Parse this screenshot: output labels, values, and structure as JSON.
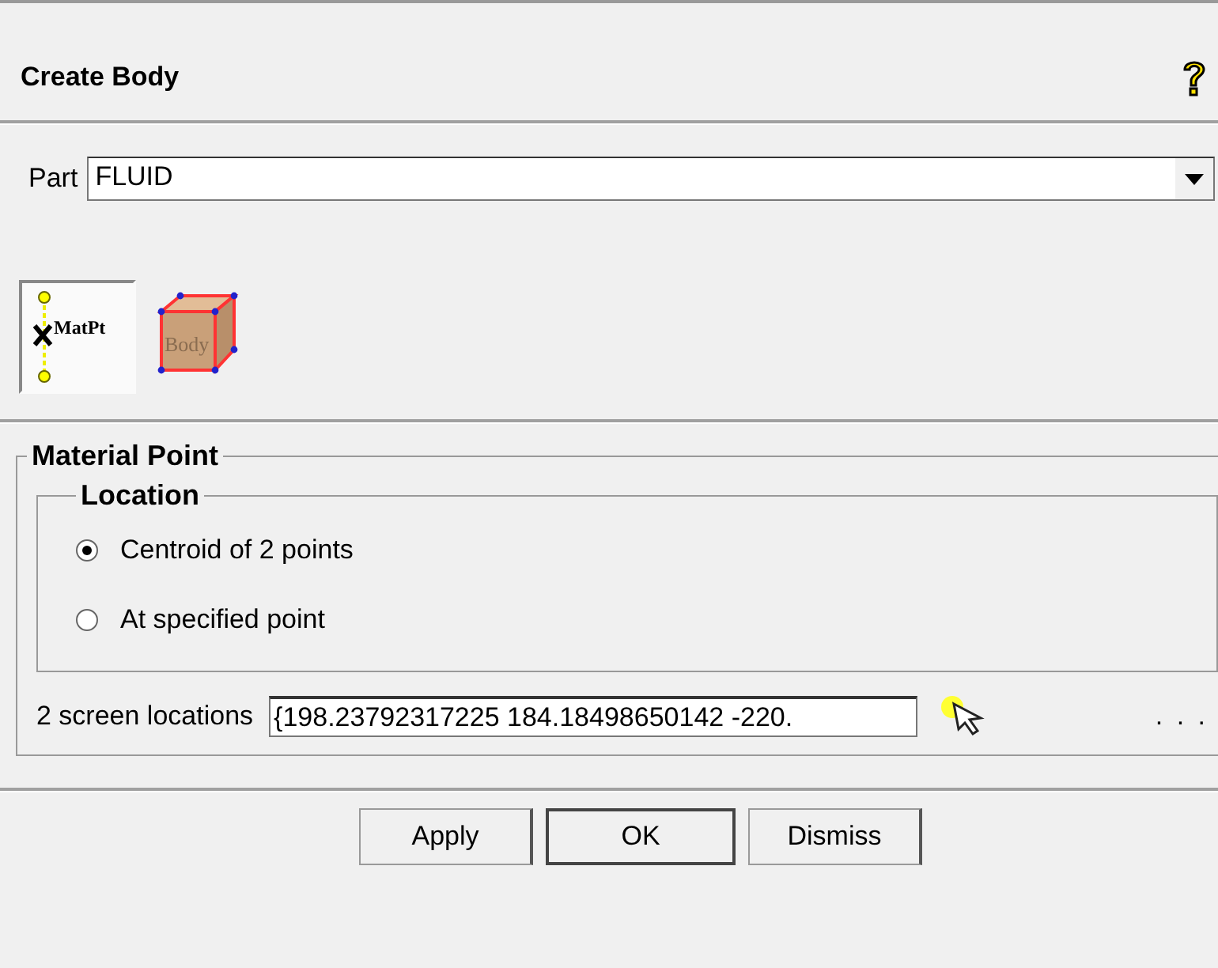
{
  "title": "Create Body",
  "part": {
    "label": "Part",
    "value": "FLUID"
  },
  "tools": [
    {
      "kind": "matpt",
      "label": "MatPt",
      "selected": true
    },
    {
      "kind": "body",
      "label": "Body",
      "selected": false
    }
  ],
  "material_point": {
    "title": "Material Point",
    "location": {
      "title": "Location",
      "options": [
        {
          "label": "Centroid of 2 points",
          "selected": true
        },
        {
          "label": "At specified point",
          "selected": false
        }
      ]
    },
    "screen_locations": {
      "label": "2 screen locations",
      "value": "{198.23792317225 184.18498650142 -220.",
      "more": ". . ."
    }
  },
  "buttons": [
    {
      "label": "Apply",
      "default": false
    },
    {
      "label": "OK",
      "default": true
    },
    {
      "label": "Dismiss",
      "default": false
    }
  ]
}
